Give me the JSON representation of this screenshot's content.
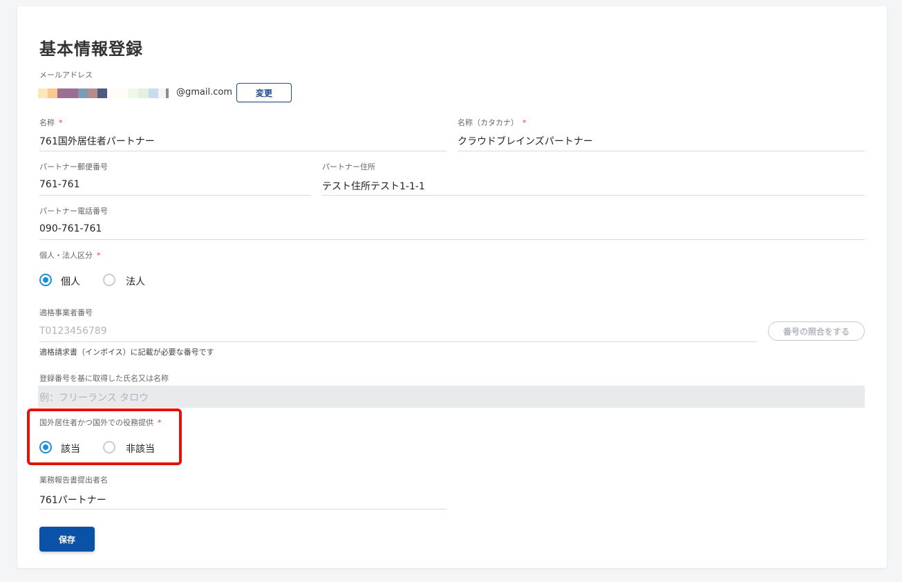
{
  "form": {
    "title": "基本情報登録",
    "email": {
      "label": "メールアドレス",
      "suffix": "@gmail.com",
      "change_label": "変更"
    },
    "name": {
      "label": "名称",
      "value": "761国外居住者パートナー"
    },
    "name_kana": {
      "label": "名称（カタカナ）",
      "value": "クラウドブレインズパートナー"
    },
    "postal": {
      "label": "パートナー郵便番号",
      "value": "761-761"
    },
    "address": {
      "label": "パートナー住所",
      "value": "テスト住所テスト1-1-1"
    },
    "phone": {
      "label": "パートナー電話番号",
      "value": "090-761-761"
    },
    "entity_type": {
      "label": "個人・法人区分",
      "options": [
        "個人",
        "法人"
      ],
      "selected": "個人"
    },
    "invoice_number": {
      "label": "適格事業者番号",
      "placeholder": "T0123456789",
      "verify_label": "番号の照合をする",
      "help": "適格請求書（インボイス）に記載が必要な番号です"
    },
    "registered_name": {
      "label": "登録番号を基に取得した氏名又は名称",
      "placeholder": "例：フリーランス タロウ"
    },
    "overseas": {
      "label": "国外居住者かつ国外での役務提供",
      "options": [
        "該当",
        "非該当"
      ],
      "selected": "該当"
    },
    "report_submitter": {
      "label": "業務報告書提出者名",
      "value": "761パートナー"
    },
    "required_mark": "*",
    "save_label": "保存"
  },
  "colors": {
    "primary": "#0a52a8",
    "radio_checked": "#1a8fd8",
    "required": "#e53935",
    "highlight": "#e3120b"
  }
}
